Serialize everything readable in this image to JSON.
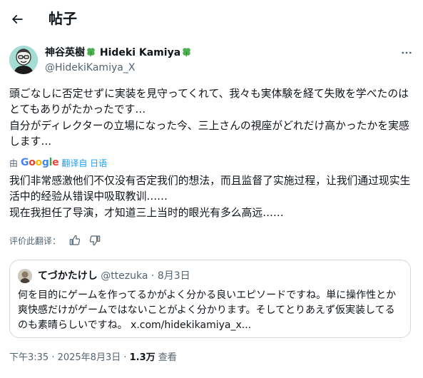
{
  "header": {
    "title": "帖子"
  },
  "author": {
    "name": "神谷英樹",
    "name_en": "Hideki Kamiya",
    "handle": "@HidekiKamiya_X",
    "clover_emoji": "clover"
  },
  "post": {
    "text": "頭ごなしに否定せずに実装を見守ってくれて、我々も実体験を経て失敗を学べたのはとてもありがたかったです…\n自分がディレクターの立場になった今、三上さんの視座がどれだけ高かったかを実感します…",
    "translated_by_label": "由",
    "google_label": "Google",
    "translate_link_label": "翻译自 日语",
    "translated_text": "我们非常感激他们不仅没有否定我们的想法，而且监督了实施过程，让我们通过现实生活中的经验从错误中吸取教训……\n现在我担任了导演，才知道三上当时的眼光有多么高远……",
    "rate_label": "评价此翻译："
  },
  "quote": {
    "name": "てづかたけし",
    "handle": "@ttezuka",
    "date": "8月3日",
    "separator": "·",
    "text": "何を目的にゲームを作ってるかがよく分かる良いエピソードですね。単に操作性とか爽快感だけがゲームではないことがよく分かります。そしてとりあえず仮実装してるのも素晴らしいですね。",
    "link": "x.com/hidekikamiya_x..."
  },
  "meta": {
    "timestamp": "下午3:35 · 2025年8月3日 · ",
    "views_count": "1.3万",
    "views_label": "查看"
  },
  "colors": {
    "accent": "#1d9bf0",
    "text_primary": "#0f1419",
    "text_secondary": "#536471",
    "border": "#cfd9de",
    "clover": "#4caf50"
  }
}
